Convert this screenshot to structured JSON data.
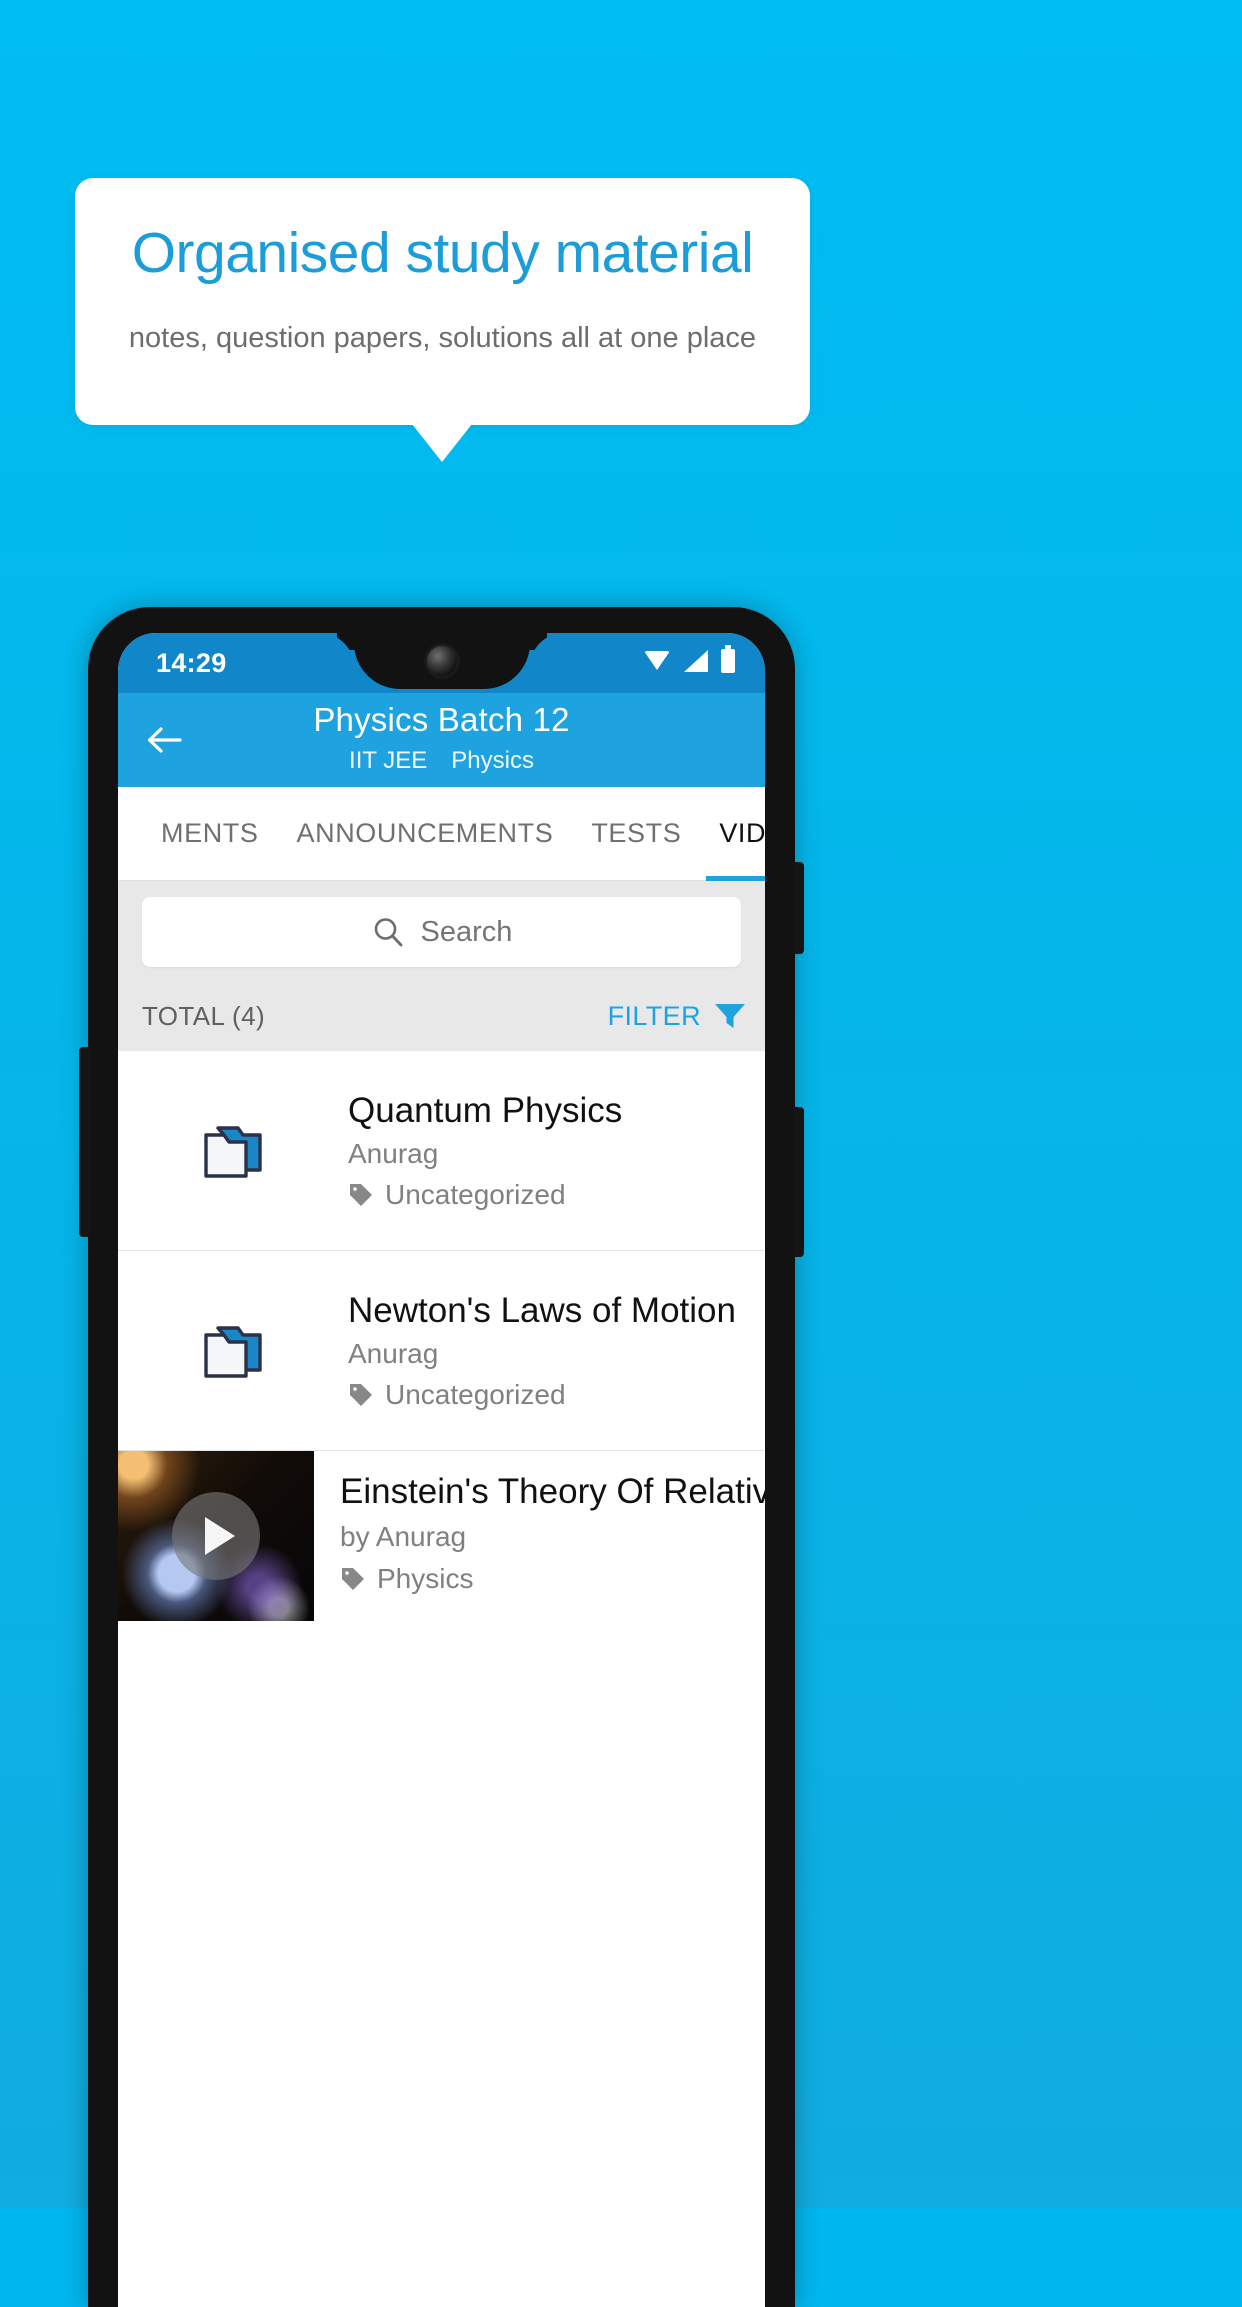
{
  "promo": {
    "title": "Organised study material",
    "subtitle": "notes, question papers, solutions all at one place",
    "accent_color": "#1b9dd9",
    "background_color": "#00bdf2"
  },
  "phone": {
    "status_bar": {
      "time": "14:29",
      "icons": [
        "wifi-icon",
        "signal-icon",
        "battery-icon"
      ],
      "background_color": "#1187c9"
    },
    "app_bar": {
      "back_icon": "back-arrow-icon",
      "title": "Physics Batch 12",
      "exam": "IIT JEE",
      "subject": "Physics",
      "background_color": "#1fa2e0"
    },
    "tabs": [
      {
        "label": "MENTS",
        "active": false
      },
      {
        "label": "ANNOUNCEMENTS",
        "active": false
      },
      {
        "label": "TESTS",
        "active": false
      },
      {
        "label": "VIDEOS",
        "active": true
      }
    ],
    "search": {
      "icon": "search-icon",
      "placeholder": "Search",
      "value": ""
    },
    "toolbar": {
      "total_label": "TOTAL (4)",
      "filter_label": "FILTER",
      "filter_icon": "filter-funnel-icon"
    },
    "list": [
      {
        "type": "folder",
        "icon": "folder-icon",
        "title": "Quantum Physics",
        "author": "Anurag",
        "tag_icon": "tag-icon",
        "tag": "Uncategorized"
      },
      {
        "type": "folder",
        "icon": "folder-icon",
        "title": "Newton's Laws of Motion",
        "author": "Anurag",
        "tag_icon": "tag-icon",
        "tag": "Uncategorized"
      },
      {
        "type": "video",
        "icon": "play-icon",
        "title": "Einstein's Theory Of Relativity",
        "author": "by Anurag",
        "tag_icon": "tag-icon",
        "tag": "Physics"
      }
    ]
  }
}
